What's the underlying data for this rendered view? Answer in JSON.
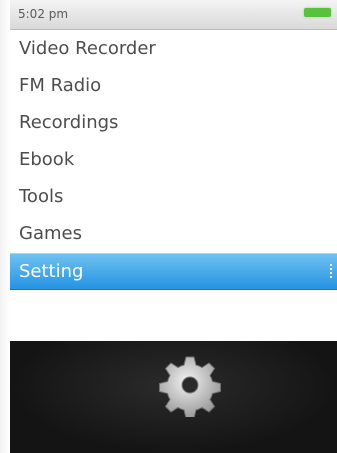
{
  "status": {
    "time": "5:02 pm",
    "battery_icon": "battery-full-icon"
  },
  "menu": {
    "items": [
      {
        "label": "Video Recorder"
      },
      {
        "label": "FM Radio"
      },
      {
        "label": "Recordings"
      },
      {
        "label": "Ebook"
      },
      {
        "label": "Tools"
      },
      {
        "label": "Games"
      },
      {
        "label": "Setting",
        "selected": true
      }
    ]
  },
  "preview": {
    "icon": "gear-icon"
  },
  "colors": {
    "selection": "#2e98e4",
    "battery": "#59c23c",
    "preview_bg": "#1a1a1a"
  }
}
